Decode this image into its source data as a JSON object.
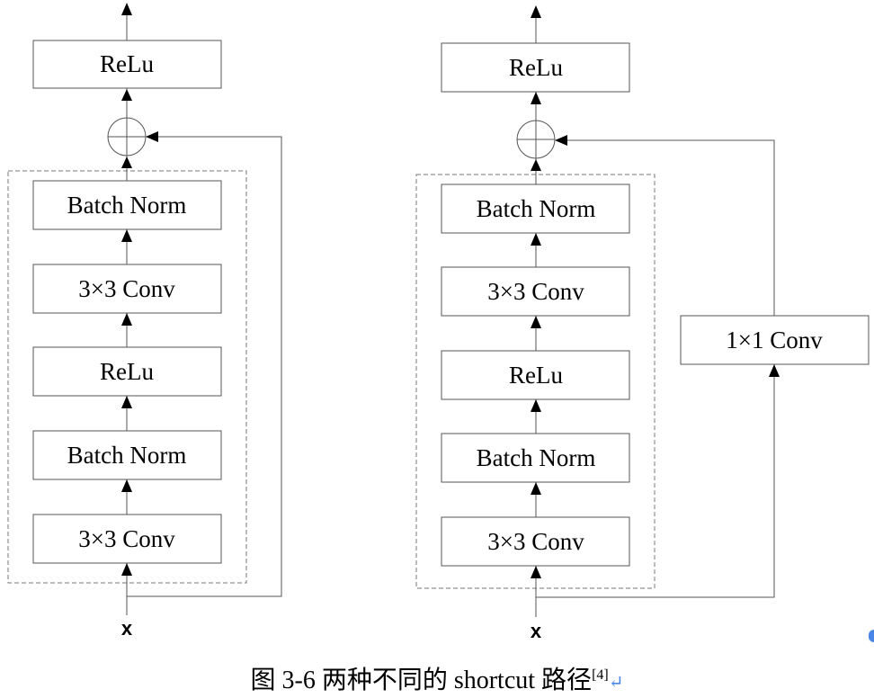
{
  "diagrams": [
    {
      "id": "identity-shortcut",
      "blocks": [
        "3×3 Conv",
        "Batch Norm",
        "ReLu",
        "3×3 Conv",
        "Batch Norm"
      ],
      "output_block": "ReLu",
      "input_label": "x",
      "shortcut_block": null
    },
    {
      "id": "projection-shortcut",
      "blocks": [
        "3×3 Conv",
        "Batch Norm",
        "ReLu",
        "3×3 Conv",
        "Batch Norm"
      ],
      "output_block": "ReLu",
      "input_label": "x",
      "shortcut_block": "1×1 Conv"
    }
  ],
  "caption": {
    "text": "图 3-6  两种不同的 shortcut 路径",
    "citation": "[4]",
    "return_mark": "↵"
  },
  "colors": {
    "line": "#555555",
    "return_mark": "#4a86e8"
  }
}
